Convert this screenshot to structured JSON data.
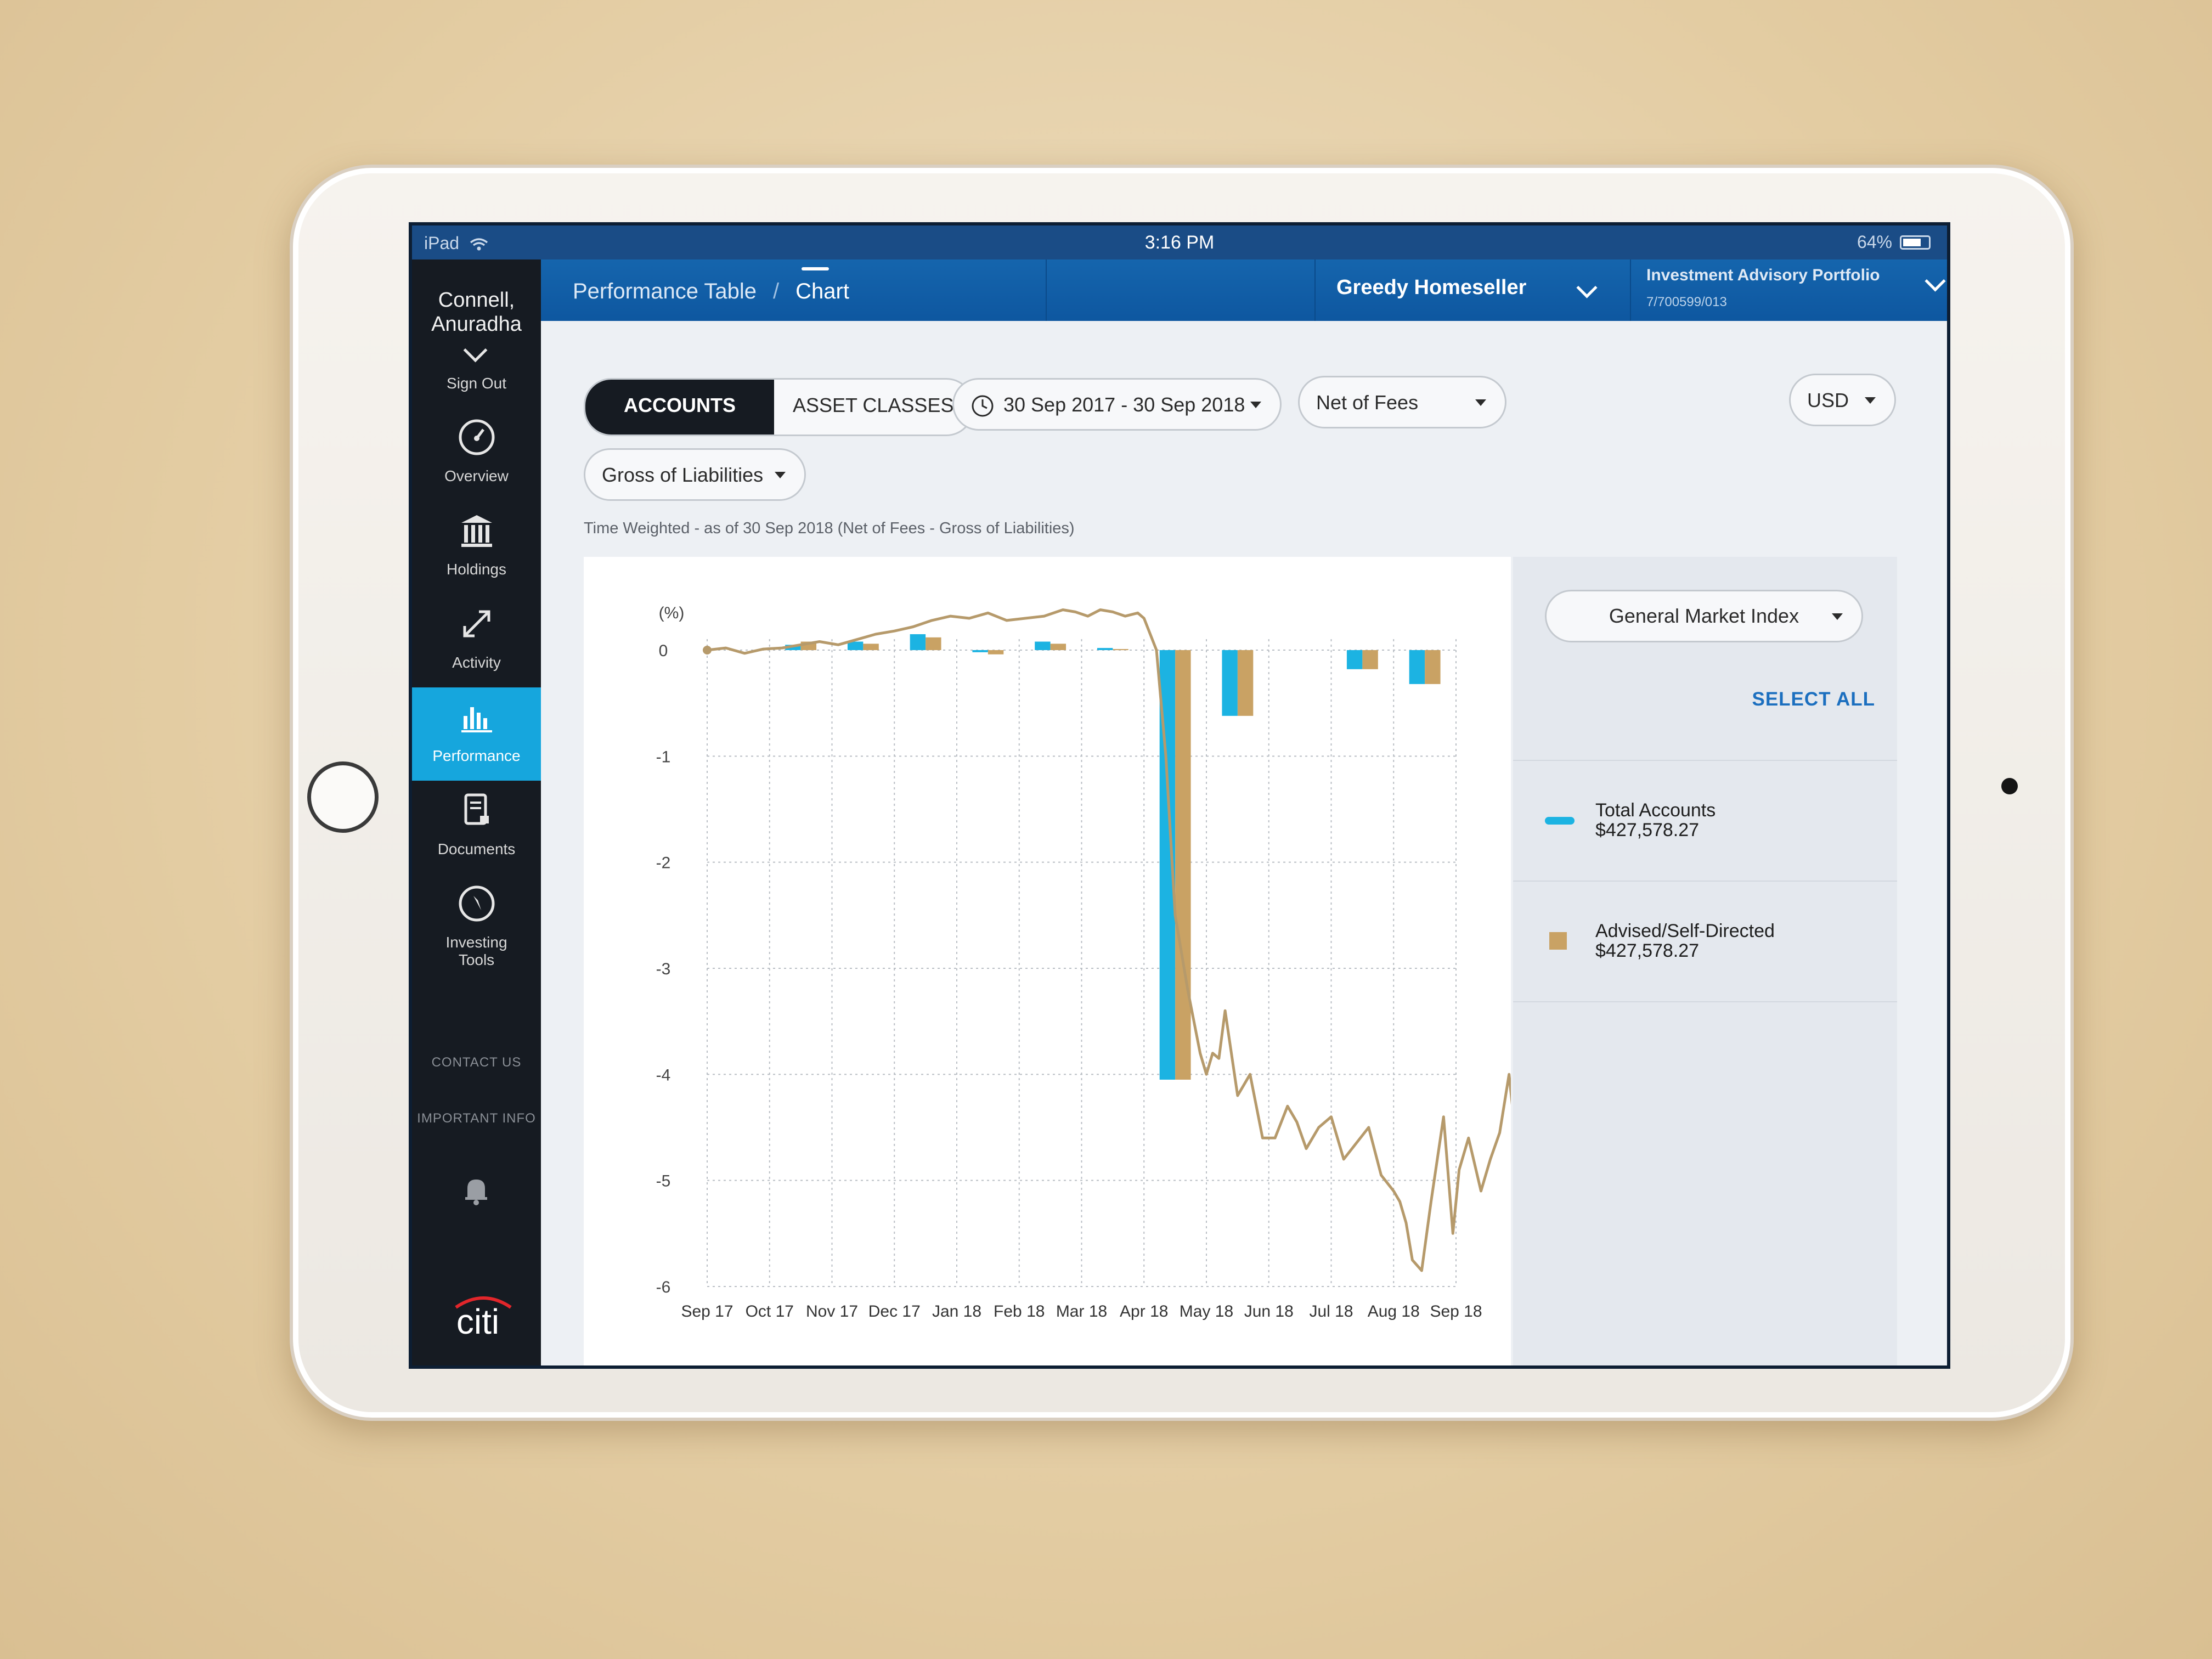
{
  "status_bar": {
    "device": "iPad",
    "time": "3:16 PM",
    "battery": "64%"
  },
  "sidebar": {
    "user_name": "Connell, Anuradha",
    "sign_out": "Sign Out",
    "nav": [
      {
        "label": "Overview",
        "icon": "speedometer-icon"
      },
      {
        "label": "Holdings",
        "icon": "bank-icon"
      },
      {
        "label": "Activity",
        "icon": "transfer-arrows-icon"
      },
      {
        "label": "Performance",
        "icon": "bar-chart-icon"
      },
      {
        "label": "Documents",
        "icon": "document-lock-icon"
      },
      {
        "label": "Investing Tools",
        "icon": "compass-icon"
      }
    ],
    "contact_us": "CONTACT US",
    "important_info": "IMPORTANT INFO",
    "logo": "citi"
  },
  "topnav": {
    "breadcrumb_1": "Performance Table",
    "breadcrumb_sep": "/",
    "breadcrumb_2": "Chart",
    "client": "Greedy Homeseller",
    "portfolio_name": "Investment Advisory Portfolio",
    "portfolio_number": "7/700599/013"
  },
  "filters": {
    "accounts": "ACCOUNTS",
    "asset_classes": "ASSET CLASSES",
    "date_range": "30 Sep 2017 - 30 Sep 2018",
    "fees": "Net of Fees",
    "currency": "USD",
    "liabilities": "Gross of Liabilities"
  },
  "subtitle": "Time Weighted - as of 30 Sep 2018 (Net of Fees - Gross of Liabilities)",
  "legend_panel": {
    "index_selector": "General Market Index",
    "select_all": "SELECT ALL",
    "items": [
      {
        "name": "Total Accounts",
        "value": "$427,578.27",
        "color": "#1cb3e2"
      },
      {
        "name": "Advised/Self-Directed",
        "value": "$427,578.27",
        "color": "#c9a264"
      }
    ]
  },
  "chart_data": {
    "type": "bar",
    "ylabel": "(%)",
    "ylim": [
      -6,
      0
    ],
    "yticks": [
      0,
      -1,
      -2,
      -3,
      -4,
      -5,
      -6
    ],
    "categories": [
      "Sep 17",
      "Oct 17",
      "Nov 17",
      "Dec 17",
      "Jan 18",
      "Feb 18",
      "Mar 18",
      "Apr 18",
      "May 18",
      "Jun 18",
      "Jul 18",
      "Aug 18",
      "Sep 18"
    ],
    "series": [
      {
        "name": "Total Accounts",
        "color": "#1cb3e2",
        "values": [
          0.0,
          0.05,
          0.08,
          0.15,
          -0.02,
          0.08,
          0.02,
          -4.05,
          -0.62,
          0.0,
          -0.18,
          -0.32,
          0.0
        ]
      },
      {
        "name": "Advised/Self-Directed",
        "color": "#c9a264",
        "values": [
          0.0,
          0.08,
          0.06,
          0.12,
          -0.04,
          0.06,
          0.01,
          -4.05,
          -0.62,
          0.0,
          -0.18,
          -0.32,
          0.0
        ]
      }
    ],
    "market_index_line": {
      "name": "General Market Index",
      "color": "#b69a6b",
      "x": [
        0.0,
        0.3,
        0.6,
        0.9,
        1.2,
        1.5,
        1.8,
        2.1,
        2.4,
        2.7,
        3.0,
        3.3,
        3.6,
        3.9,
        4.2,
        4.5,
        4.8,
        5.1,
        5.4,
        5.7,
        5.9,
        6.1,
        6.3,
        6.5,
        6.7,
        6.9,
        7.0,
        7.2,
        7.35,
        7.5,
        7.7,
        7.9,
        8.0,
        8.1,
        8.2,
        8.3,
        8.5,
        8.7,
        8.9,
        9.1,
        9.3,
        9.45,
        9.6,
        9.8,
        10.0,
        10.2,
        10.4,
        10.6,
        10.8,
        11.0,
        11.1,
        11.2,
        11.3,
        11.45,
        11.6,
        11.8,
        11.95,
        12.05,
        12.2,
        12.4,
        12.55,
        12.7,
        12.85,
        13.0
      ],
      "y": [
        0.0,
        0.02,
        -0.03,
        0.01,
        0.02,
        0.05,
        0.08,
        0.05,
        0.1,
        0.15,
        0.18,
        0.22,
        0.28,
        0.32,
        0.3,
        0.35,
        0.28,
        0.3,
        0.32,
        0.38,
        0.36,
        0.32,
        0.38,
        0.36,
        0.32,
        0.35,
        0.3,
        0.0,
        -1.0,
        -2.5,
        -3.2,
        -3.8,
        -4.0,
        -3.8,
        -3.85,
        -3.4,
        -4.2,
        -4.0,
        -4.6,
        -4.6,
        -4.3,
        -4.45,
        -4.7,
        -4.5,
        -4.4,
        -4.8,
        -4.65,
        -4.5,
        -4.95,
        -5.1,
        -5.2,
        -5.4,
        -5.75,
        -5.85,
        -5.2,
        -4.4,
        -5.5,
        -4.9,
        -4.6,
        -5.1,
        -4.8,
        -4.55,
        -4.0,
        -4.85
      ]
    },
    "grid": true
  }
}
